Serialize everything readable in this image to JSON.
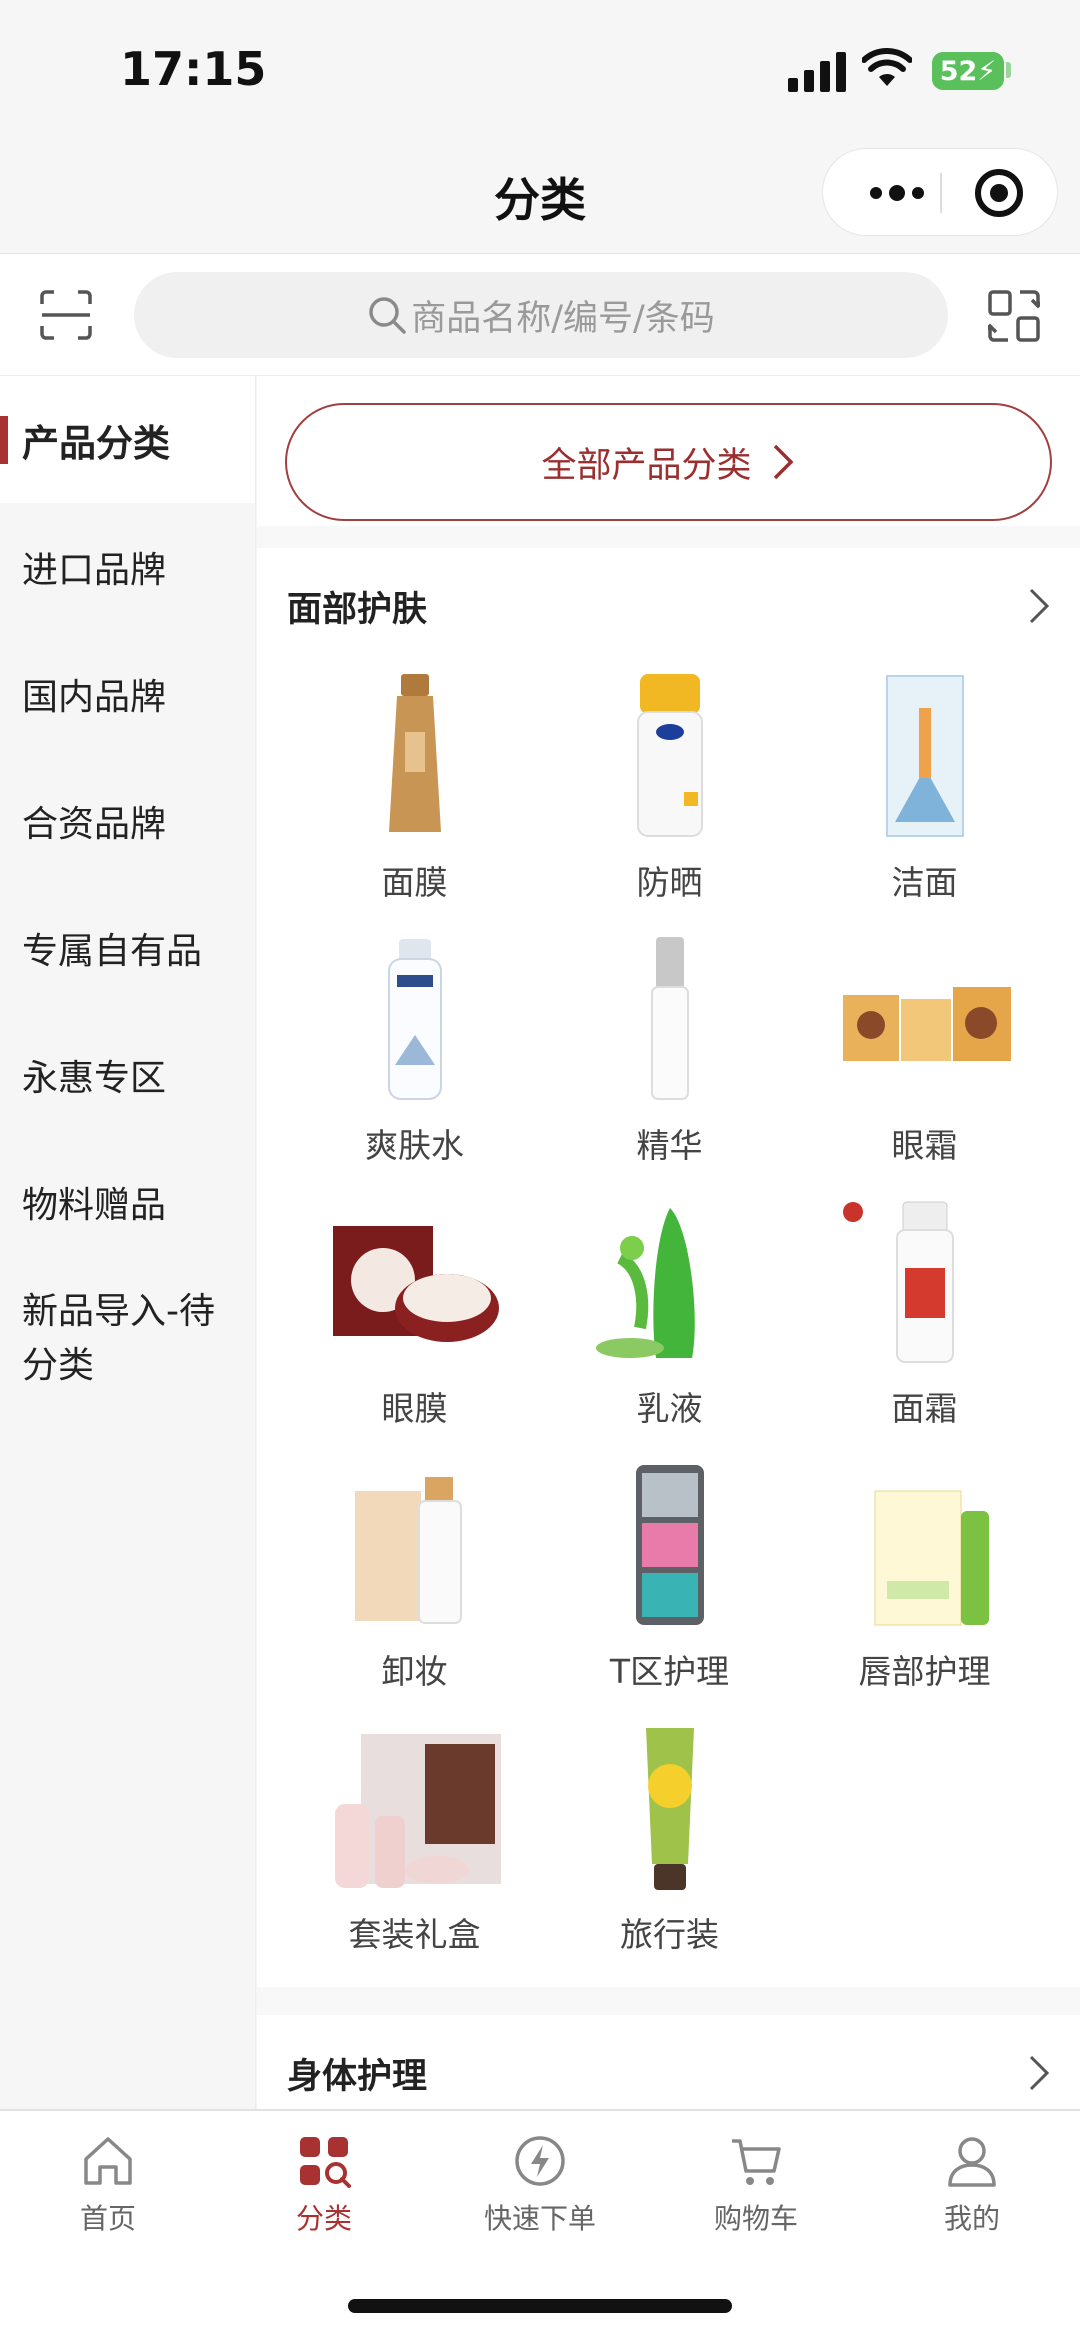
{
  "status_bar": {
    "time": "17:15",
    "battery": "52"
  },
  "navbar": {
    "title": "分类"
  },
  "search": {
    "placeholder": "商品名称/编号/条码"
  },
  "sidebar": {
    "items": [
      {
        "label": "产品分类",
        "active": true
      },
      {
        "label": "进口品牌"
      },
      {
        "label": "国内品牌"
      },
      {
        "label": "合资品牌"
      },
      {
        "label": "专属自有品"
      },
      {
        "label": "永惠专区"
      },
      {
        "label": "物料赠品"
      },
      {
        "label": "新品导入-待分类"
      }
    ]
  },
  "main": {
    "all_button": "全部产品分类",
    "sections": [
      {
        "title": "面部护肤",
        "items": [
          {
            "label": "面膜",
            "icon": "tube-bottle-icon"
          },
          {
            "label": "防晒",
            "icon": "sunscreen-bottle-icon"
          },
          {
            "label": "洁面",
            "icon": "cleanser-box-icon"
          },
          {
            "label": "爽肤水",
            "icon": "toner-bottle-icon"
          },
          {
            "label": "精华",
            "icon": "serum-bottle-icon"
          },
          {
            "label": "眼霜",
            "icon": "eye-cream-pack-icon"
          },
          {
            "label": "眼膜",
            "icon": "eye-mask-jar-icon"
          },
          {
            "label": "乳液",
            "icon": "aloe-gel-icon"
          },
          {
            "label": "面霜",
            "icon": "cream-pump-icon"
          },
          {
            "label": "卸妆",
            "icon": "makeup-remover-icon"
          },
          {
            "label": "T区护理",
            "icon": "nose-strip-icon"
          },
          {
            "label": "唇部护理",
            "icon": "lip-balm-icon"
          },
          {
            "label": "套装礼盒",
            "icon": "gift-set-icon"
          },
          {
            "label": "旅行装",
            "icon": "travel-tube-icon"
          }
        ]
      },
      {
        "title": "身体护理",
        "items": []
      }
    ]
  },
  "tabbar": {
    "items": [
      {
        "label": "首页",
        "icon": "home-icon"
      },
      {
        "label": "分类",
        "icon": "category-icon",
        "active": true
      },
      {
        "label": "快速下单",
        "icon": "lightning-icon"
      },
      {
        "label": "购物车",
        "icon": "cart-icon"
      },
      {
        "label": "我的",
        "icon": "user-icon"
      }
    ]
  },
  "colors": {
    "accent": "#a83232",
    "battery": "#5ac05c"
  }
}
